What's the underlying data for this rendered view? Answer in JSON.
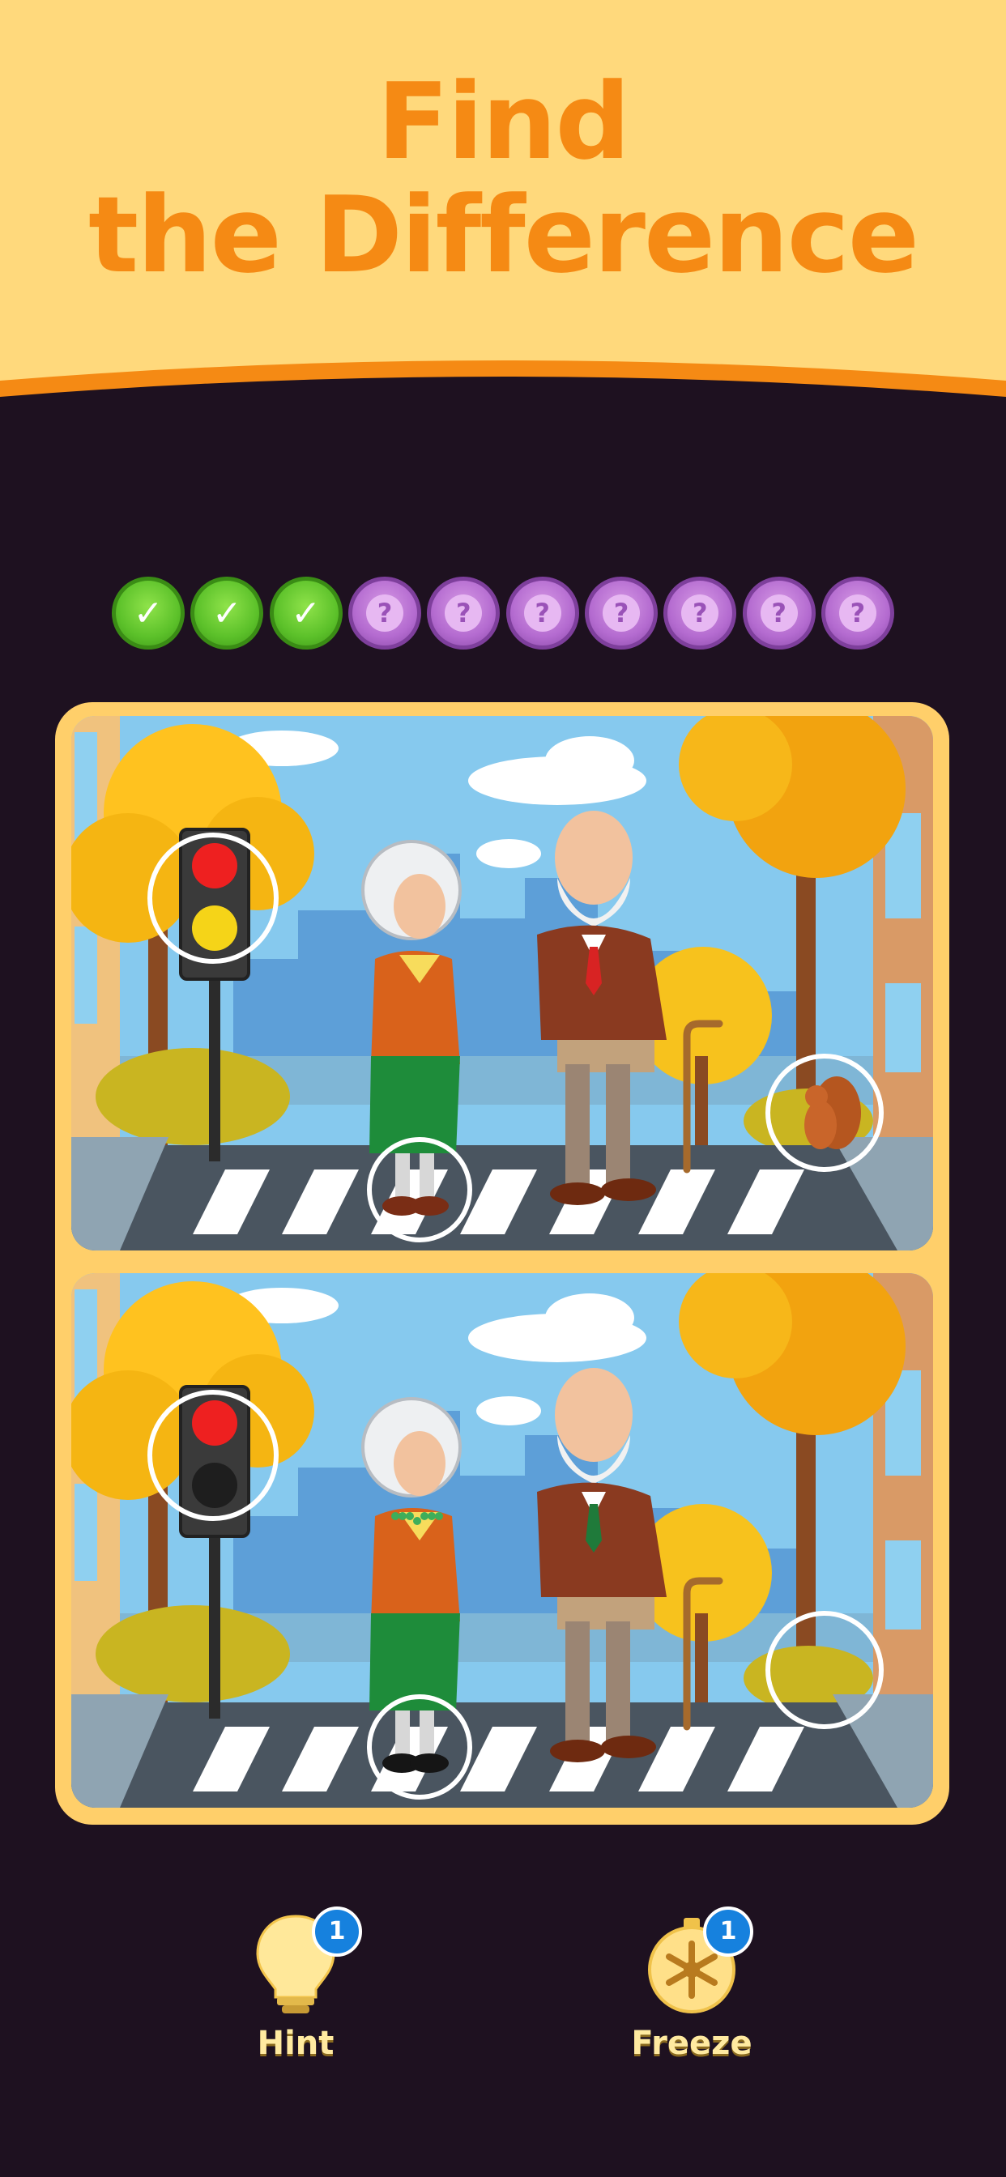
{
  "header": {
    "title_line1": "Find",
    "title_line2": "the Difference",
    "colors": {
      "banner": "#ffd97c",
      "band": "#f58a14"
    }
  },
  "progress": {
    "total": 10,
    "found": 3,
    "items": [
      "found",
      "found",
      "found",
      "pending",
      "pending",
      "pending",
      "pending",
      "pending",
      "pending",
      "pending"
    ],
    "found_icon": "check-icon",
    "pending_icon": "question-icon",
    "pending_glyph": "?",
    "found_glyph": "✓"
  },
  "scenes": {
    "top": {
      "name": "original-scene",
      "traffic_light_bottom": "yellow",
      "woman_necklace": false,
      "squirrel_visible": true,
      "shoe_color": "brown",
      "tie_color": "red"
    },
    "bottom": {
      "name": "modified-scene",
      "traffic_light_bottom": "off",
      "woman_necklace": true,
      "squirrel_visible": false,
      "shoe_color": "black",
      "tie_color": "green"
    }
  },
  "tools": {
    "hint": {
      "label": "Hint",
      "count": "1",
      "icon": "lightbulb-icon"
    },
    "freeze": {
      "label": "Freeze",
      "count": "1",
      "icon": "snowflake-timer-icon"
    }
  }
}
